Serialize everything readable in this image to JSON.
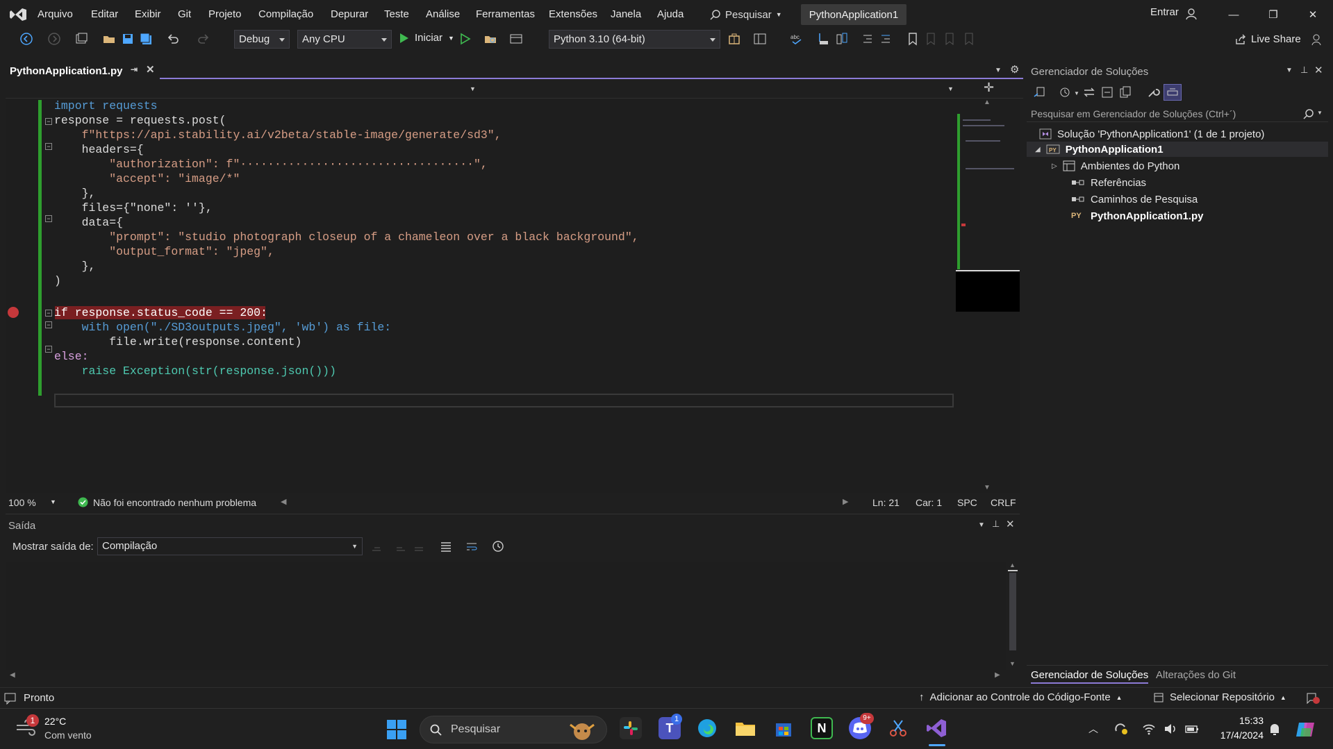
{
  "menu": {
    "items": [
      "Arquivo",
      "Editar",
      "Exibir",
      "Git",
      "Projeto",
      "Compilação",
      "Depurar",
      "Teste",
      "Análise",
      "Ferramentas",
      "Extensões",
      "Janela",
      "Ajuda"
    ],
    "search_label": "Pesquisar",
    "project_title": "PythonApplication1",
    "sign_in": "Entrar"
  },
  "toolbar": {
    "config": "Debug",
    "platform": "Any CPU",
    "start_label": "Iniciar",
    "environment": "Python 3.10 (64-bit)",
    "live_share": "Live Share"
  },
  "editor": {
    "tab_title": "PythonApplication1.py",
    "code": [
      {
        "text": "import requests"
      },
      {
        "text": "response = requests.post("
      },
      {
        "text": "    f\"https://api.stability.ai/v2beta/stable-image/generate/sd3\","
      },
      {
        "text": "    headers={"
      },
      {
        "text": "        \"authorization\": f\"··································\","
      },
      {
        "text": "        \"accept\": \"image/*\""
      },
      {
        "text": "    },"
      },
      {
        "text": "    files={\"none\": ''},"
      },
      {
        "text": "    data={"
      },
      {
        "text": "        \"prompt\": \"studio photograph closeup of a chameleon over a black background\","
      },
      {
        "text": "        \"output_format\": \"jpeg\","
      },
      {
        "text": "    },"
      },
      {
        "text": ")"
      },
      {
        "text": ""
      },
      {
        "text": "if response.status_code == 200:"
      },
      {
        "text": "    with open(\"./SD3outputs.jpeg\", 'wb') as file:"
      },
      {
        "text": "        file.write(response.content)"
      },
      {
        "text": "else:"
      },
      {
        "text": "    raise Exception(str(response.json()))"
      }
    ]
  },
  "editor_status": {
    "zoom": "100 %",
    "issues": "Não foi encontrado nenhum problema",
    "line": "Ln: 21",
    "char": "Car: 1",
    "spc": "SPC",
    "eol": "CRLF"
  },
  "output": {
    "title": "Saída",
    "show_from_label": "Mostrar saída de:",
    "source": "Compilação"
  },
  "solution_explorer": {
    "title": "Gerenciador de Soluções",
    "search_placeholder": "Pesquisar em Gerenciador de Soluções (Ctrl+´)",
    "solution": "Solução 'PythonApplication1' (1 de 1 projeto)",
    "project": "PythonApplication1",
    "items": [
      "Ambientes do Python",
      "Referências",
      "Caminhos de Pesquisa",
      "PythonApplication1.py"
    ],
    "tab_active": "Gerenciador de Soluções",
    "tab_git": "Alterações do Git"
  },
  "statusbar": {
    "ready": "Pronto",
    "source_control": "Adicionar ao Controle do Código-Fonte",
    "repo": "Selecionar Repositório"
  },
  "taskbar": {
    "temp": "22°C",
    "weather": "Com vento",
    "search": "Pesquisar",
    "time": "15:33",
    "date": "17/4/2024",
    "weather_badge": "1",
    "teams_badge": "1",
    "discord_badge": "9+"
  },
  "colors": {
    "accent": "#8c7bd6",
    "breakpoint": "#c5383b",
    "bp_highlight": "#7a1f21",
    "green_bar": "#2e9e2e"
  }
}
